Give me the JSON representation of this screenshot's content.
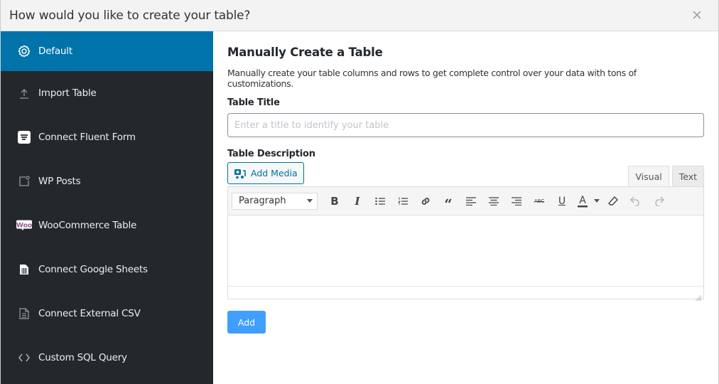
{
  "dialog": {
    "title": "How would you like to create your table?",
    "close_icon": "close-icon"
  },
  "sidebar": {
    "items": [
      {
        "label": "Default",
        "icon": "gear-icon",
        "active": true
      },
      {
        "label": "Import Table",
        "icon": "upload-icon",
        "active": false
      },
      {
        "label": "Connect Fluent Form",
        "icon": "fluent-form-icon",
        "active": false
      },
      {
        "label": "WP Posts",
        "icon": "wp-posts-icon",
        "active": false
      },
      {
        "label": "WooCommerce Table",
        "icon": "woocommerce-icon",
        "active": false
      },
      {
        "label": "Connect Google Sheets",
        "icon": "spreadsheet-icon",
        "active": false
      },
      {
        "label": "Connect External CSV",
        "icon": "document-icon",
        "active": false
      },
      {
        "label": "Custom SQL Query",
        "icon": "code-icon",
        "active": false
      }
    ]
  },
  "main": {
    "title": "Manually Create a Table",
    "description": "Manually create your table columns and rows to get complete control over your data with tons of customizations.",
    "table_title_label": "Table Title",
    "table_title_placeholder": "Enter a title to identify your table",
    "table_title_value": "",
    "table_description_label": "Table Description",
    "add_media_label": "Add Media",
    "editor_tabs": [
      "Visual",
      "Text"
    ],
    "active_editor_tab": "Visual",
    "format_select": "Paragraph",
    "toolbar_buttons": [
      "bold",
      "italic",
      "bulleted-list",
      "numbered-list",
      "link",
      "blockquote",
      "align-left",
      "align-center",
      "align-right",
      "strikethrough",
      "underline",
      "text-color",
      "text-color-dropdown",
      "clear-formatting",
      "undo",
      "redo"
    ],
    "editor_content": "",
    "add_button_label": "Add"
  },
  "colors": {
    "sidebar_bg": "#23282d",
    "active_item_bg": "#0073aa",
    "primary_button": "#409eff",
    "woocommerce_purple": "#96588a"
  }
}
